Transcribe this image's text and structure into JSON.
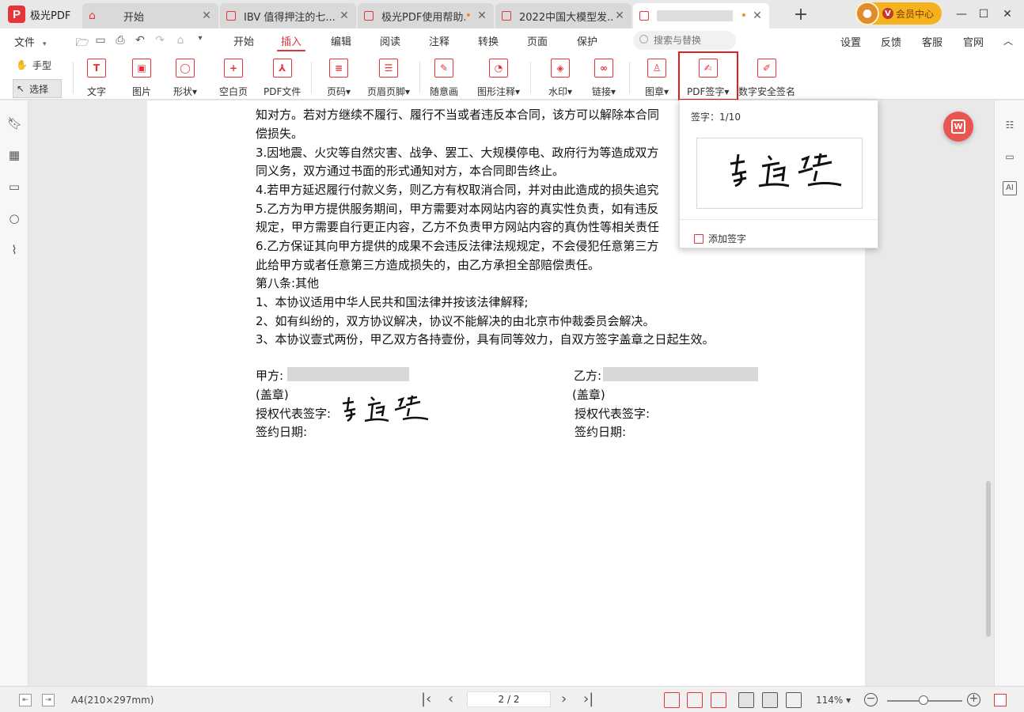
{
  "app": {
    "name": "极光PDF",
    "logo_letter": "P"
  },
  "tabs": [
    {
      "label": "开始",
      "type": "home",
      "active": false,
      "modified": false
    },
    {
      "label": "IBV 值得押注的七...",
      "type": "pdf",
      "active": false,
      "modified": false
    },
    {
      "label": "极光PDF使用帮助.p...",
      "type": "pdf",
      "active": false,
      "modified": true
    },
    {
      "label": "2022中国大模型发...",
      "type": "pdf",
      "active": false,
      "modified": false
    },
    {
      "label": "",
      "type": "pdf",
      "active": true,
      "modified": true
    }
  ],
  "vip": {
    "badge": "V",
    "label": "会员中心"
  },
  "window_controls": {
    "minimize": "—",
    "maximize": "☐",
    "close": "✕"
  },
  "menu": {
    "file": "文件",
    "items": [
      "开始",
      "插入",
      "编辑",
      "阅读",
      "注释",
      "转换",
      "页面",
      "保护"
    ],
    "active": "插入",
    "search_placeholder": "搜索与替换",
    "right": [
      "设置",
      "反馈",
      "客服",
      "官网"
    ]
  },
  "toolbar": {
    "hand": "手型",
    "select": "选择",
    "tools": [
      {
        "label": "文字",
        "glyph": "T"
      },
      {
        "label": "图片",
        "glyph": "▣"
      },
      {
        "label": "形状▾",
        "glyph": "◯"
      },
      {
        "label": "空白页",
        "glyph": "+"
      },
      {
        "label": "PDF文件",
        "glyph": "⅄"
      },
      {
        "label": "页码▾",
        "glyph": "≡"
      },
      {
        "label": "页眉页脚▾",
        "glyph": "☰"
      },
      {
        "label": "随意画",
        "glyph": "✎"
      },
      {
        "label": "图形注释▾",
        "glyph": "◔"
      },
      {
        "label": "水印▾",
        "glyph": "◈"
      },
      {
        "label": "链接▾",
        "glyph": "∞"
      },
      {
        "label": "图章▾",
        "glyph": "♙"
      },
      {
        "label": "PDF签字▾",
        "glyph": "✍"
      },
      {
        "label": "数字安全签名",
        "glyph": "✐"
      }
    ]
  },
  "document": {
    "lines": [
      "知对方。若对方继续不履行、履行不当或者违反本合同，该方可以解除本合同",
      "偿损失。",
      "3.因地震、火灾等自然灾害、战争、罢工、大规模停电、政府行为等造成双方",
      "同义务，双方通过书面的形式通知对方，本合同即告终止。",
      "4.若甲方延迟履行付款义务，则乙方有权取消合同，并对由此造成的损失追究",
      "5.乙方为甲方提供服务期间，甲方需要对本网站内容的真实性负责，如有违反",
      "规定，甲方需要自行更正内容，乙方不负责甲方网站内容的真伪性等相关责任",
      "6.乙方保证其向甲方提供的成果不会违反法律法规规定，不会侵犯任意第三方",
      "此给甲方或者任意第三方造成损失的，由乙方承担全部赔偿责任。",
      "第八条:其他",
      "1、本协议适用中华人民共和国法律并按该法律解释;",
      "2、如有纠纷的，双方协议解决，协议不能解决的由北京市仲裁委员会解决。",
      "3、本协议壹式两份，甲乙双方各持壹份，具有同等效力，自双方签字盖章之日起生效。"
    ],
    "party_a": {
      "label": "甲方:",
      "seal": "(盖章)",
      "rep": "授权代表签字:",
      "date": "签约日期:"
    },
    "party_b": {
      "label": "乙方:",
      "seal": "(盖章)",
      "rep": "授权代表签字:",
      "date": "签约日期:"
    },
    "signature_name": "李道遥"
  },
  "signature_popup": {
    "count_label": "签字：1/10",
    "add_label": "添加签字"
  },
  "statusbar": {
    "paper_size": "A4(210×297mm)",
    "page_display": "2 / 2",
    "zoom": "114%",
    "nav": {
      "first": "|‹",
      "prev": "‹",
      "next": "›",
      "last": "›|"
    },
    "zoom_out": "−",
    "zoom_in": "+",
    "zoom_caret": "▾"
  }
}
